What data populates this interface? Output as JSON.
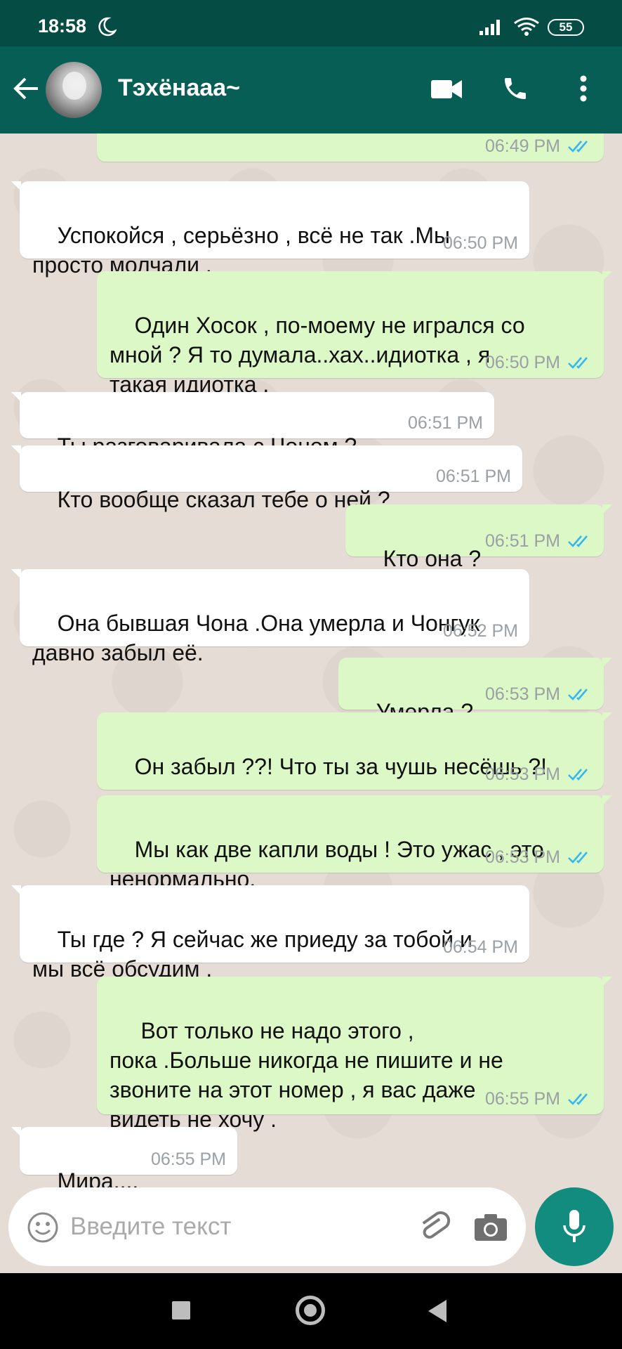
{
  "status_bar": {
    "time": "18:58",
    "battery": "55"
  },
  "header": {
    "contact_name": "Тэхёнааа~"
  },
  "messages": [
    {
      "dir": "out",
      "text": "",
      "time": "06:49 PM"
    },
    {
      "dir": "in",
      "text": "Успокойся , серьёзно , всё не так .Мы\nпросто молчали .",
      "time": "06:50 PM"
    },
    {
      "dir": "out",
      "text": "Один Хосок , по-моему не игрался со\nмной ? Я то думала..хах..идиотка , я\nтакая идиотка .",
      "time": "06:50 PM"
    },
    {
      "dir": "in",
      "text": "Ты разговаривала с Чоном ?",
      "time": "06:51 PM"
    },
    {
      "dir": "in",
      "text": "Кто вообще сказал тебе о ней ?",
      "time": "06:51 PM"
    },
    {
      "dir": "out",
      "text": "Кто она ?",
      "time": "06:51 PM"
    },
    {
      "dir": "in",
      "text": "Она бывшая Чона .Она умерла и Чонгук\nдавно забыл её.",
      "time": "06:52 PM"
    },
    {
      "dir": "out",
      "text": "Умерла ?",
      "time": "06:53 PM"
    },
    {
      "dir": "out",
      "text": "Он забыл ??! Что ты за чушь несёшь ?!",
      "time": "06:53 PM"
    },
    {
      "dir": "out",
      "text": "Мы как две капли воды ! Это ужас , это\nненормально.",
      "time": "06:53 PM"
    },
    {
      "dir": "in",
      "text": "Ты где ? Я сейчас же приеду за тобой и\nмы всё обсудим .",
      "time": "06:54 PM"
    },
    {
      "dir": "out",
      "text": " Вот только не надо этого ,\nпока .Больше никогда не пишите и не\nзвоните на этот номер , я вас даже\nвидеть не хочу .",
      "time": "06:55 PM"
    },
    {
      "dir": "in",
      "text": "Мира....",
      "time": "06:55 PM"
    }
  ],
  "composer": {
    "placeholder": "Введите текст"
  },
  "colors": {
    "header": "#075e54",
    "status_bar": "#054d44",
    "outgoing": "#dcf8c6",
    "incoming": "#ffffff",
    "read_ticks": "#34b7f1",
    "mic_button": "#128c7e"
  }
}
